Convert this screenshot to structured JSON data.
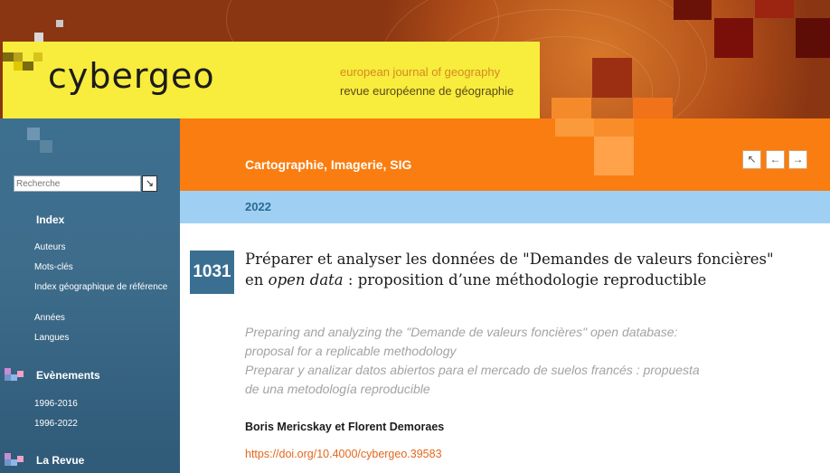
{
  "header": {
    "logo_text": "cybergeo",
    "tagline_en": "european journal of geography",
    "tagline_fr": "revue européenne de géographie"
  },
  "sidebar": {
    "search_placeholder": "Recherche",
    "search_button_icon": "arrow-down-right-icon",
    "sections": [
      {
        "title": "Index",
        "items": [
          "Auteurs",
          "Mots-clés",
          "Index géographique de référence",
          "Années",
          "Langues"
        ]
      },
      {
        "title": "Evènements",
        "items": [
          "1996-2016",
          "1996-2022"
        ]
      },
      {
        "title": "La Revue",
        "items": []
      }
    ]
  },
  "section_band": {
    "title": "Cartographie, Imagerie, SIG",
    "nav": [
      {
        "icon": "arrow-up-left-icon",
        "glyph": "↖"
      },
      {
        "icon": "arrow-left-icon",
        "glyph": "←"
      },
      {
        "icon": "arrow-right-icon",
        "glyph": "→"
      }
    ]
  },
  "year_band": {
    "year": "2022"
  },
  "article": {
    "number": "1031",
    "title_part1": "Préparer et analyser les données de \"Demandes de valeurs foncières\" en ",
    "title_italic": "open data",
    "title_part2": " : proposition d’une méthodologie reproductible",
    "subtitle_en_1": "Preparing and analyzing the \"Demande de valeurs foncières\" open database:",
    "subtitle_en_2": "proposal for a replicable methodology",
    "subtitle_es_1": "Preparar y analizar datos abiertos para el mercado de suelos francés : propuesta",
    "subtitle_es_2": "de una metodología reproducible",
    "authors": "Boris Mericskay et Florent Demoraes",
    "doi": "https://doi.org/10.4000/cybergeo.39583"
  },
  "colors": {
    "header_brown": "#8a3612",
    "logo_yellow": "#f8ec3c",
    "sidebar_blue": "#3d6f8f",
    "orange": "#f97d10",
    "light_blue": "#9fd0f3",
    "badge_blue": "#3b6f91",
    "doi_orange": "#e3681b"
  }
}
